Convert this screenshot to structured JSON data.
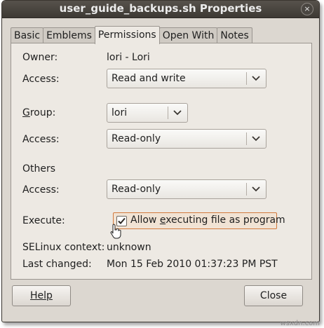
{
  "window": {
    "title": "user_guide_backups.sh Properties",
    "close_glyph": "×"
  },
  "tabs": [
    {
      "label": "Basic",
      "active": false
    },
    {
      "label": "Emblems",
      "active": false
    },
    {
      "label": "Permissions",
      "active": true
    },
    {
      "label": "Open With",
      "active": false
    },
    {
      "label": "Notes",
      "active": false
    }
  ],
  "permissions": {
    "owner_label": "Owner:",
    "owner_value": "lori - Lori",
    "owner_access_label": "Access:",
    "owner_access_value": "Read and write",
    "group_label": "Group:",
    "group_value": "lori",
    "group_access_label": "Access:",
    "group_access_value": "Read-only",
    "others_heading": "Others",
    "others_access_label": "Access:",
    "others_access_value": "Read-only",
    "execute_label": "Execute:",
    "execute_checkbox_label": "Allow executing file as program",
    "execute_checked": true,
    "selinux_label": "SELinux context:",
    "selinux_value": "unknown",
    "last_changed_label": "Last changed:",
    "last_changed_value": "Mon 15 Feb 2010 01:37:23 PM PST"
  },
  "buttons": {
    "help": "Help",
    "close": "Close"
  },
  "watermark": "wsxdn.com",
  "colors": {
    "titlebar": "#3d3934",
    "dialog_bg": "#dcd7d0",
    "panel_bg": "#ede9e3",
    "checkbox_highlight": "#d27a3c"
  }
}
